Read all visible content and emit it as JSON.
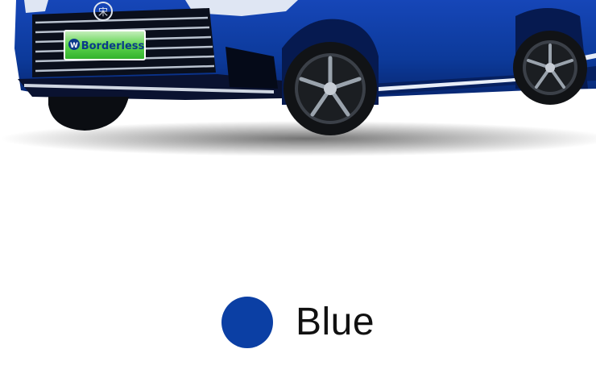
{
  "product_image": {
    "plate_text": "Borderless"
  },
  "color_option": {
    "label": "Blue",
    "swatch_hex": "#0b3fa4"
  },
  "colors": {
    "body": "#0c3a9a",
    "body_dark": "#072670",
    "plate_green": "#3fc23a",
    "plate_text": "#0a3a8a"
  }
}
